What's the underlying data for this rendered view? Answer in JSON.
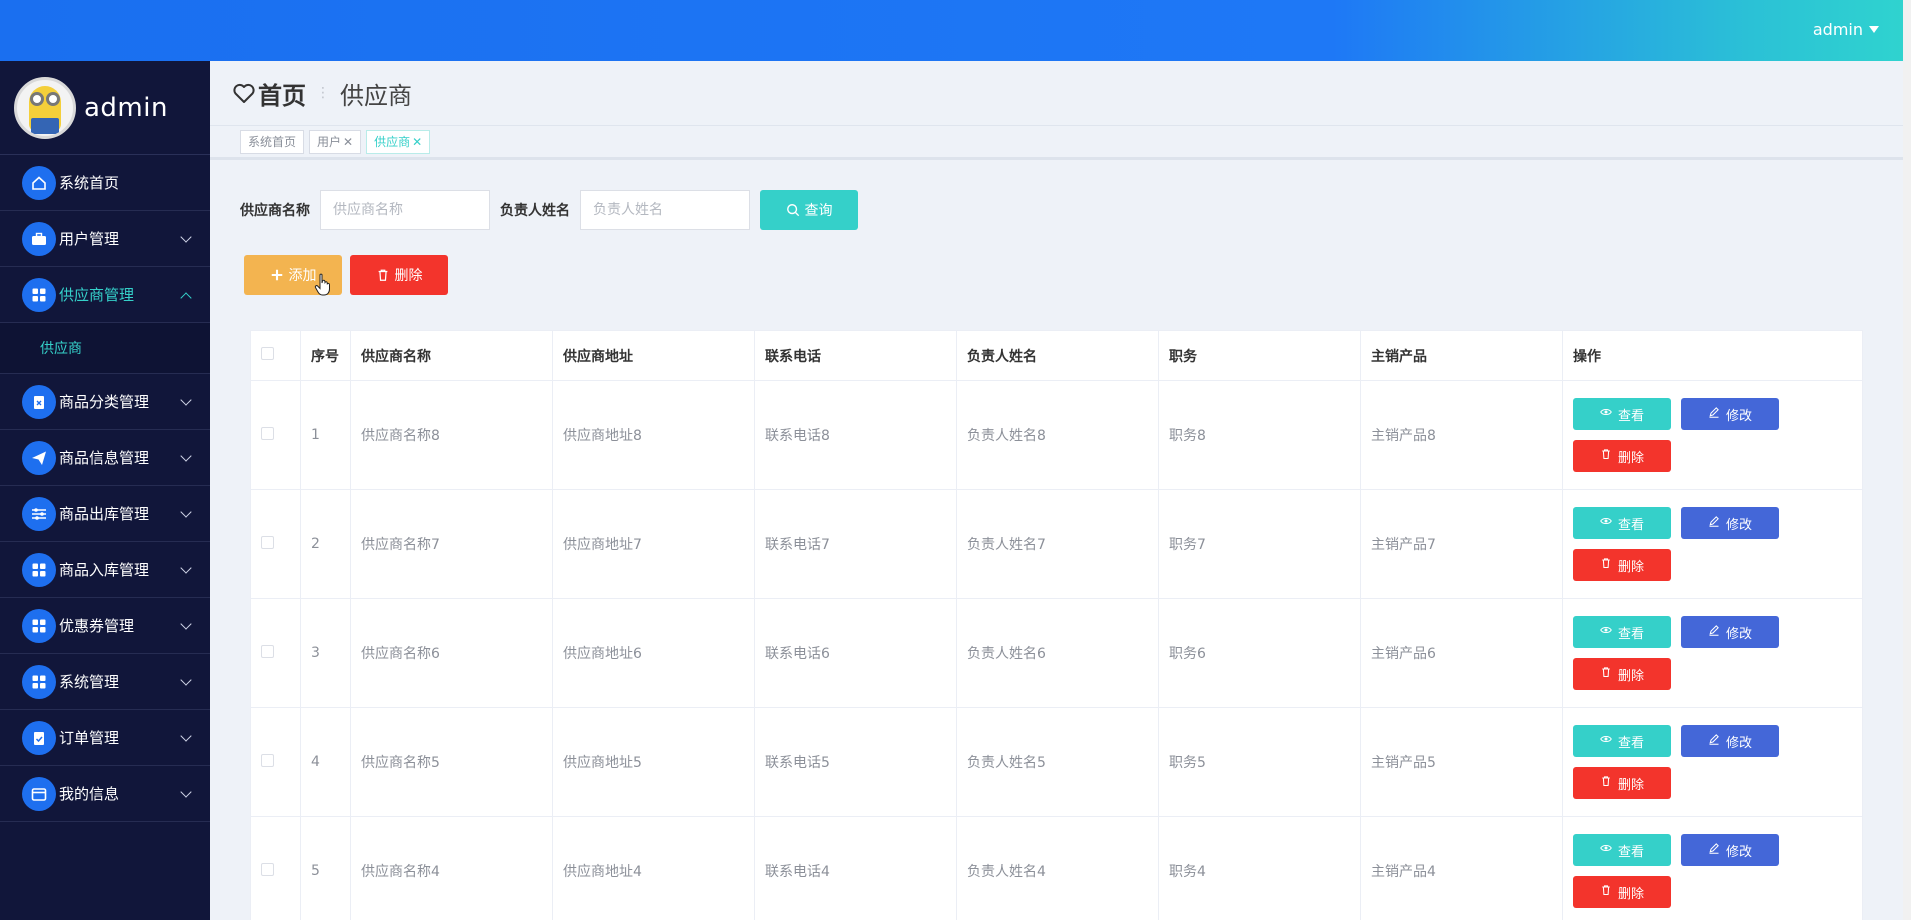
{
  "header": {
    "username": "admin"
  },
  "sidebar": {
    "profile_name": "admin",
    "items": [
      {
        "label": "系统首页",
        "icon": "home-icon",
        "has_arrow": false
      },
      {
        "label": "用户管理",
        "icon": "briefcase-icon",
        "has_arrow": true
      },
      {
        "label": "供应商管理",
        "icon": "grid-icon",
        "has_arrow": true,
        "expanded": true,
        "sub": [
          {
            "label": "供应商"
          }
        ]
      },
      {
        "label": "商品分类管理",
        "icon": "clipboard-icon",
        "has_arrow": true
      },
      {
        "label": "商品信息管理",
        "icon": "send-icon",
        "has_arrow": true
      },
      {
        "label": "商品出库管理",
        "icon": "sliders-icon",
        "has_arrow": true
      },
      {
        "label": "商品入库管理",
        "icon": "grid-icon",
        "has_arrow": true
      },
      {
        "label": "优惠券管理",
        "icon": "grid-icon",
        "has_arrow": true
      },
      {
        "label": "系统管理",
        "icon": "grid-icon",
        "has_arrow": true
      },
      {
        "label": "订单管理",
        "icon": "clipboard-check-icon",
        "has_arrow": true
      },
      {
        "label": "我的信息",
        "icon": "wallet-icon",
        "has_arrow": true
      }
    ]
  },
  "breadcrumb": {
    "home": "首页",
    "current": "供应商"
  },
  "tags": [
    {
      "label": "系统首页",
      "closable": false,
      "active": false
    },
    {
      "label": "用户",
      "closable": true,
      "active": false
    },
    {
      "label": "供应商",
      "closable": true,
      "active": true
    }
  ],
  "search": {
    "supplier_name_label": "供应商名称",
    "supplier_name_placeholder": "供应商名称",
    "contact_name_label": "负责人姓名",
    "contact_name_placeholder": "负责人姓名",
    "query_label": "查询"
  },
  "actions": {
    "add_label": "添加",
    "delete_label": "删除"
  },
  "table": {
    "columns": [
      "序号",
      "供应商名称",
      "供应商地址",
      "联系电话",
      "负责人姓名",
      "职务",
      "主销产品",
      "操作"
    ],
    "rows": [
      {
        "index": "1",
        "name": "供应商名称8",
        "address": "供应商地址8",
        "phone": "联系电话8",
        "contact": "负责人姓名8",
        "position": "职务8",
        "product": "主销产品8"
      },
      {
        "index": "2",
        "name": "供应商名称7",
        "address": "供应商地址7",
        "phone": "联系电话7",
        "contact": "负责人姓名7",
        "position": "职务7",
        "product": "主销产品7"
      },
      {
        "index": "3",
        "name": "供应商名称6",
        "address": "供应商地址6",
        "phone": "联系电话6",
        "contact": "负责人姓名6",
        "position": "职务6",
        "product": "主销产品6"
      },
      {
        "index": "4",
        "name": "供应商名称5",
        "address": "供应商地址5",
        "phone": "联系电话5",
        "contact": "负责人姓名5",
        "position": "职务5",
        "product": "主销产品5"
      },
      {
        "index": "5",
        "name": "供应商名称4",
        "address": "供应商地址4",
        "phone": "联系电话4",
        "contact": "负责人姓名4",
        "position": "职务4",
        "product": "主销产品4"
      }
    ],
    "row_actions": {
      "view": "查看",
      "edit": "修改",
      "delete": "删除"
    }
  },
  "colors": {
    "primary": "#1e6fef",
    "teal": "#35d0c9",
    "orange": "#f3b450",
    "red": "#f3342c",
    "edit_blue": "#4467d8",
    "sidebar_bg": "#11163a"
  }
}
